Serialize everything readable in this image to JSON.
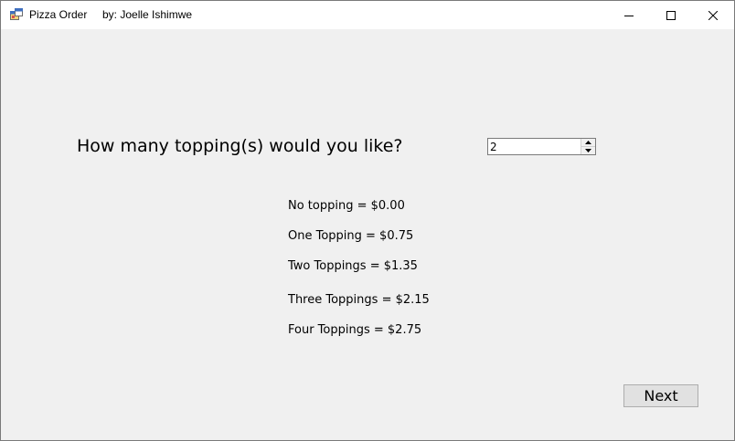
{
  "window": {
    "title": "Pizza Order",
    "author": "by: Joelle Ishimwe",
    "controls": {
      "minimize_icon": "minimize-icon",
      "maximize_icon": "maximize-icon",
      "close_icon": "close-icon"
    }
  },
  "form": {
    "question": "How many topping(s) would you like?",
    "toppings_count": "2",
    "prices": [
      "No topping = $0.00",
      "One Topping = $0.75",
      "Two Toppings = $1.35",
      "Three Toppings = $2.15",
      "Four Toppings = $2.75"
    ],
    "next_label": "Next"
  },
  "colors": {
    "client_background": "#f0f0f0",
    "titlebar_background": "#ffffff",
    "button_face": "#e1e1e1",
    "button_border": "#adadad"
  }
}
